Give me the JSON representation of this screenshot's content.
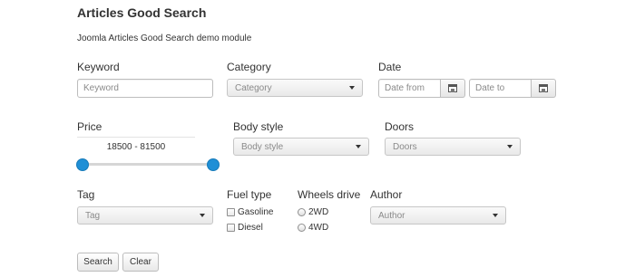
{
  "module": {
    "title": "Articles Good Search",
    "subtitle": "Joomla Articles Good Search demo module"
  },
  "keyword": {
    "label": "Keyword",
    "placeholder": "Keyword"
  },
  "category": {
    "label": "Category",
    "selected": "Category"
  },
  "date": {
    "label": "Date",
    "from_placeholder": "Date from",
    "to_placeholder": "Date to"
  },
  "price": {
    "label": "Price",
    "range_text": "18500 - 81500",
    "min": 18500,
    "max": 81500
  },
  "body_style": {
    "label": "Body style",
    "selected": "Body style"
  },
  "doors": {
    "label": "Doors",
    "selected": "Doors"
  },
  "tag": {
    "label": "Tag",
    "selected": "Tag"
  },
  "fuel_type": {
    "label": "Fuel type",
    "options": [
      "Gasoline",
      "Diesel"
    ]
  },
  "wheels_drive": {
    "label": "Wheels drive",
    "options": [
      "2WD",
      "4WD"
    ]
  },
  "author": {
    "label": "Author",
    "selected": "Author"
  },
  "buttons": {
    "search": "Search",
    "clear": "Clear"
  },
  "colors": {
    "slider_handle": "#1f8fd6",
    "track": "#d6d6d6"
  }
}
